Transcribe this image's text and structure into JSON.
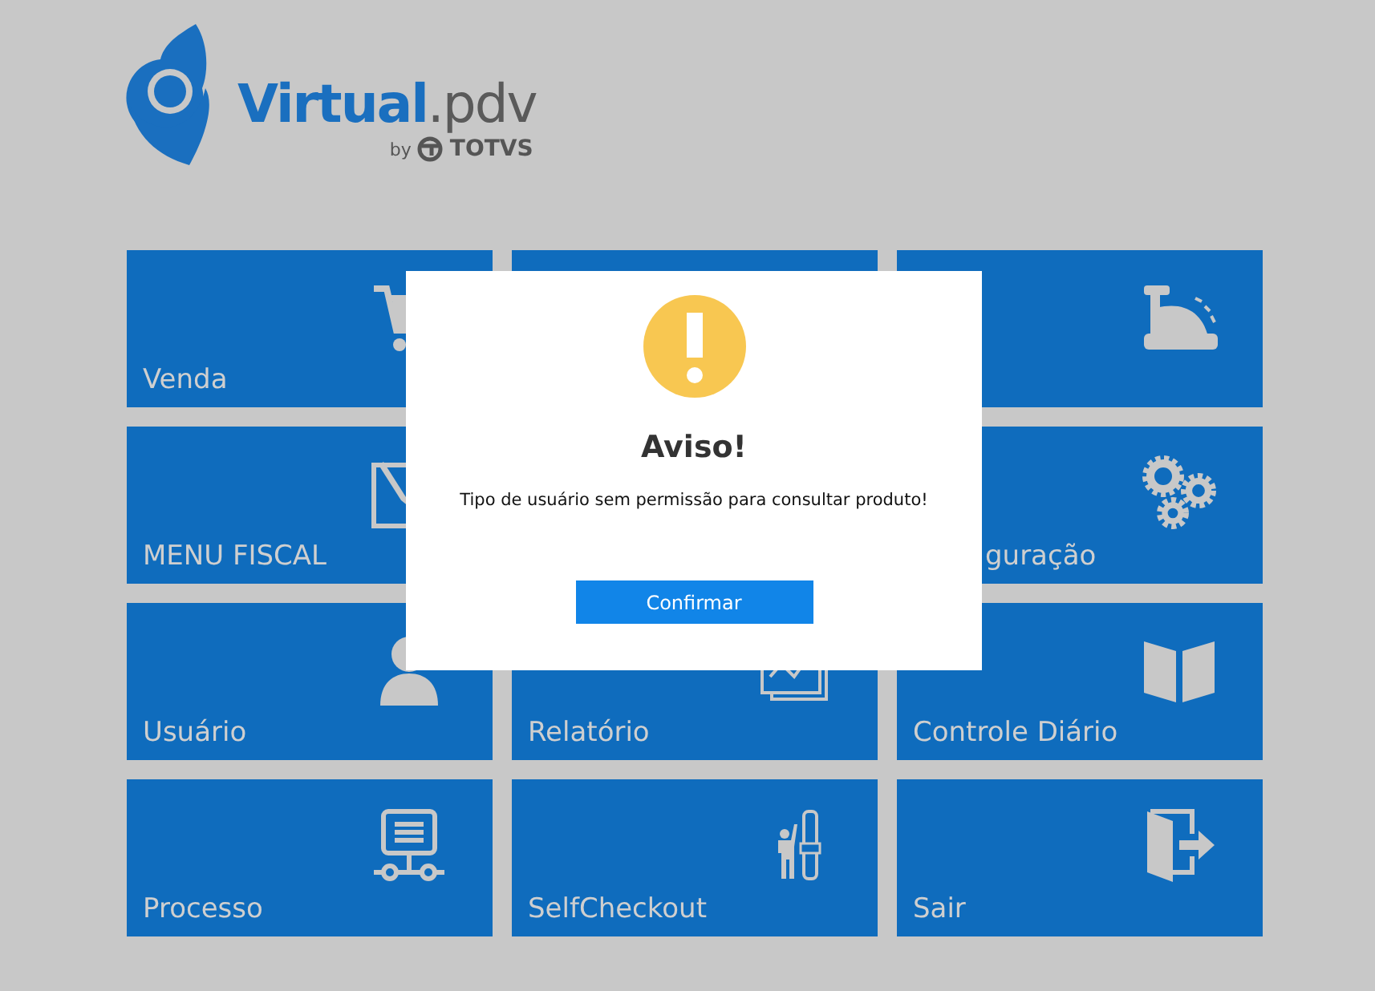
{
  "logo": {
    "name": "Virtual",
    "suffix": ".pdv",
    "by": "by",
    "company": "TOTVS"
  },
  "tiles": [
    {
      "kind": "tile",
      "label": "Venda"
    },
    {
      "kind": "tile"
    },
    {
      "kind": "tile"
    },
    {
      "kind": "tile",
      "label": "MENU FISCAL"
    },
    {
      "kind": "covered"
    },
    {
      "kind": "tile",
      "label": "guração",
      "cut": true
    },
    {
      "kind": "tile",
      "label": "Usuário"
    },
    {
      "kind": "tile",
      "label": "Relatório"
    },
    {
      "kind": "tile",
      "label": "Controle Diário"
    },
    {
      "kind": "tile",
      "label": "Processo"
    },
    {
      "kind": "tile",
      "label": "SelfCheckout"
    },
    {
      "kind": "tile",
      "label": "Sair"
    }
  ],
  "dialog": {
    "title": "Aviso!",
    "message": "Tipo de usuário sem permissão para consultar produto!",
    "button": "Confirmar"
  }
}
